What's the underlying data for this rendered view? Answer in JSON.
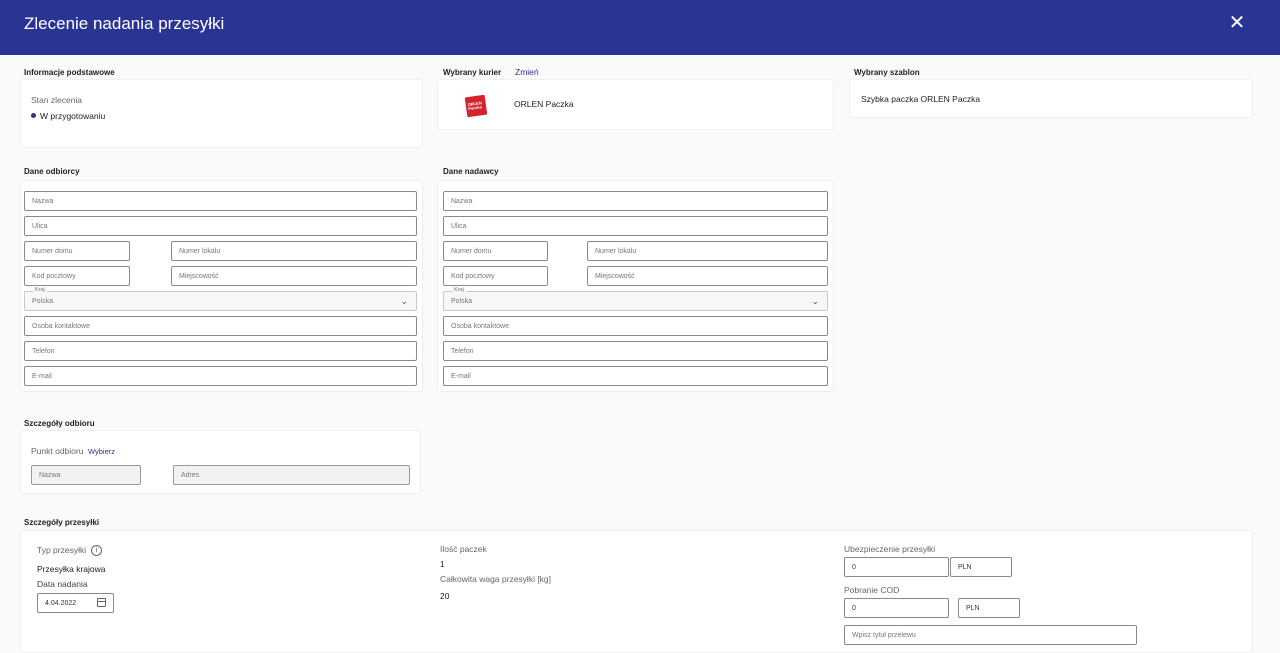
{
  "header": {
    "title": "Zlecenie nadania przesyłki",
    "close_icon": "close-icon"
  },
  "basic": {
    "section_title": "Informacje podstawowe",
    "status_label": "Stan zlecenia",
    "status_value": "W przygotowaniu",
    "status_color": "#2a3593"
  },
  "courier": {
    "section_title": "Wybrany kurier",
    "change_link": "Zmień",
    "name": "ORLEN Paczka",
    "logo_text": "ORLEN Paczka",
    "brand_color": "#d3242b"
  },
  "template": {
    "section_title": "Wybrany szablon",
    "name": "Szybka paczka ORLEN Paczka"
  },
  "recipient": {
    "section_title": "Dane odbiorcy",
    "name_ph": "Nazwa",
    "street_ph": "Ulica",
    "house_ph": "Numer domu",
    "flat_ph": "Numer lokalu",
    "postal_ph": "Kod pocztowy",
    "city_ph": "Miejscowość",
    "country_label": "Kraj",
    "country_value": "Polska",
    "contact_ph": "Osoba kontaktowe",
    "phone_ph": "Telefon",
    "email_ph": "E-mail"
  },
  "sender": {
    "section_title": "Dane nadawcy",
    "name_ph": "Nazwa",
    "street_ph": "Ulica",
    "house_ph": "Numer domu",
    "flat_ph": "Numer lokalu",
    "postal_ph": "Kod pocztowy",
    "city_ph": "Miejscowość",
    "country_label": "Kraj",
    "country_value": "Polska",
    "contact_ph": "Osoba kontaktowe",
    "phone_ph": "Telefon",
    "email_ph": "E-mail"
  },
  "pickup": {
    "section_title": "Szczegóły odbioru",
    "point_label": "Punkt odbioru",
    "choose_link": "Wybierz",
    "name_ph": "Nazwa",
    "address_ph": "Adres"
  },
  "shipment": {
    "section_title": "Szczegóły przesyłki",
    "type_label": "Typ przesyłki",
    "type_value": "Przesyłka krajowa",
    "date_label": "Data nadania",
    "date_value": "4.04.2022",
    "count_label": "Ilość paczek",
    "count_value": "1",
    "weight_label": "Całkowita waga przesyłki [kg]",
    "weight_value": "20",
    "insurance_label": "Ubezpieczenie przesyłki",
    "insurance_value": "0",
    "insurance_currency": "PLN",
    "cod_label": "Pobranie COD",
    "cod_value": "0",
    "cod_currency": "PLN",
    "transfer_title_ph": "Wpisz tytuł przelewu"
  }
}
